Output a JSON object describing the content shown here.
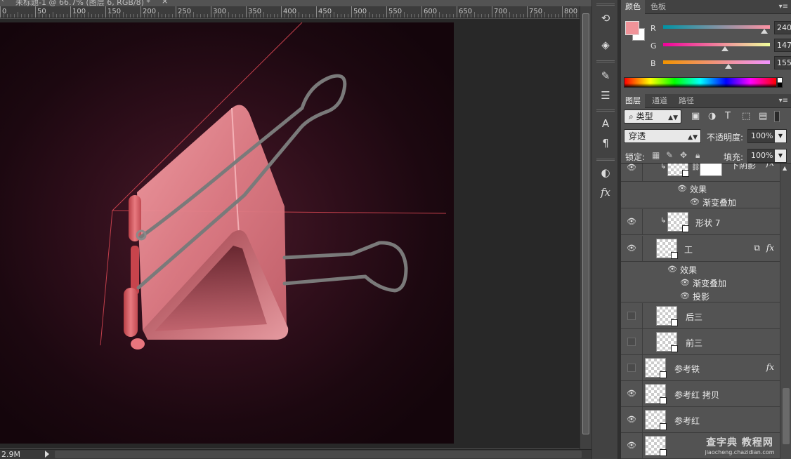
{
  "document": {
    "tab_title": "未标题-1 @ 66.7% (图层 6, RGB/8) *",
    "close_glyph": "×",
    "doc_size": "2.9M"
  },
  "ruler": {
    "labels": [
      "0",
      "50",
      "100",
      "150",
      "200",
      "250",
      "300",
      "350",
      "400",
      "450",
      "500",
      "550",
      "600",
      "650",
      "700",
      "750",
      "800"
    ]
  },
  "color_panel": {
    "tabs": [
      "颜色",
      "色板"
    ],
    "foreground_color": "#f09399",
    "background_color": "#ffffff",
    "channels": [
      {
        "label": "R",
        "value": "240",
        "fraction": 0.941
      },
      {
        "label": "G",
        "value": "147",
        "fraction": 0.576
      },
      {
        "label": "B",
        "value": "155",
        "fraction": 0.608
      }
    ]
  },
  "layers_panel": {
    "tabs": [
      "图层",
      "通道",
      "路径"
    ],
    "filter_kind": "类型",
    "blend_mode": "穿透",
    "opacity_label": "不透明度:",
    "opacity_value": "100%",
    "lock_label": "锁定:",
    "fill_label": "填充:",
    "fill_value": "100%",
    "layers": [
      {
        "name": "下阴影",
        "visible": true,
        "fx": true,
        "clipped": true,
        "has_mask": true,
        "effects_label": "效果",
        "effects": [
          "渐变叠加"
        ]
      },
      {
        "name": "形状 7",
        "visible": true,
        "fx": false,
        "clipped": true
      },
      {
        "name": "工",
        "visible": true,
        "fx": true,
        "effects_label": "效果",
        "effects": [
          "渐变叠加",
          "投影"
        ]
      },
      {
        "name": "后三",
        "visible": false,
        "fx": false
      },
      {
        "name": "前三",
        "visible": false,
        "fx": false
      },
      {
        "name": "参考铁",
        "visible": false,
        "fx": true
      },
      {
        "name": "参考红 拷贝",
        "visible": true,
        "fx": false
      },
      {
        "name": "参考红",
        "visible": true,
        "fx": false
      },
      {
        "name": "",
        "visible": true,
        "fx": false
      }
    ]
  },
  "watermark": {
    "line1": "查字典 教程网",
    "line2": "jiaocheng.chazidian.com"
  },
  "icons": {
    "strip": [
      "history-icon",
      "3d-icon",
      "brush-icon",
      "adjust-icon",
      "character-icon",
      "paragraph-icon",
      "styles-icon",
      "fx-icon"
    ]
  },
  "colors": {
    "panel_bg": "#535353",
    "canvas_dark": "#1c0810",
    "clip_pink": "#e0707a"
  }
}
